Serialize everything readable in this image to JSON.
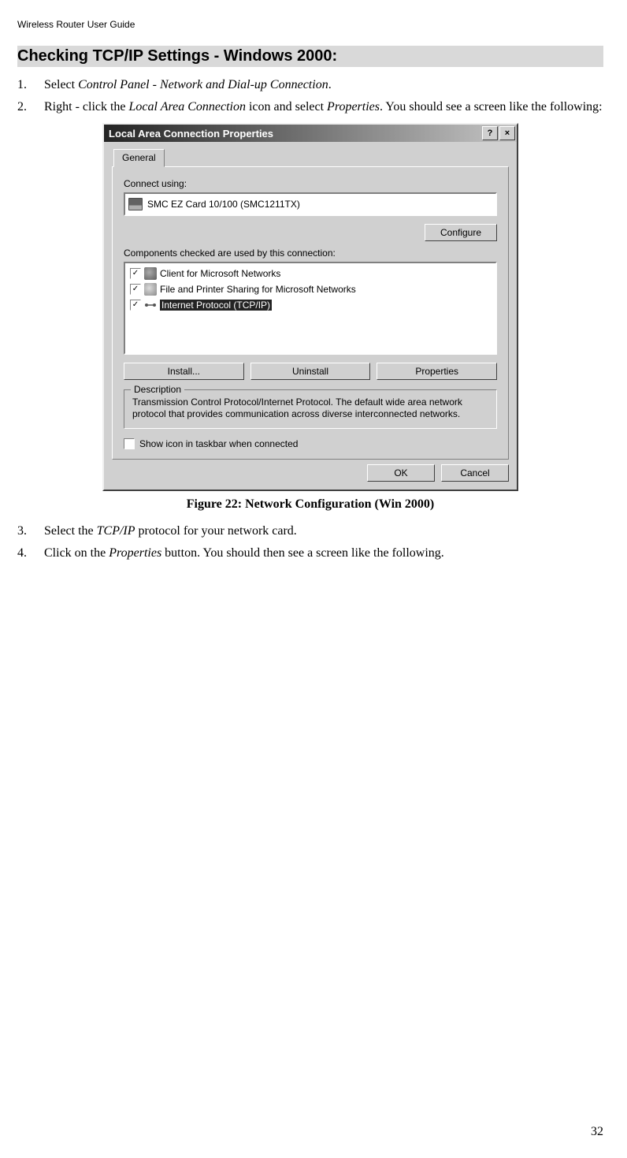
{
  "header": {
    "running_head": "Wireless Router User Guide"
  },
  "section": {
    "title": "Checking TCP/IP Settings - Windows 2000:"
  },
  "steps": {
    "s1": {
      "marker": "1.",
      "before": "Select ",
      "em": "Control Panel - Network and Dial-up Connection",
      "after": "."
    },
    "s2": {
      "marker": "2.",
      "before": "Right - click the ",
      "em1": "Local Area Connection",
      "mid": " icon and select ",
      "em2": "Properties",
      "after": ". You should see a screen like the following:"
    },
    "s3": {
      "marker": "3.",
      "before": "Select the ",
      "em": "TCP/IP",
      "after": " protocol for your network card."
    },
    "s4": {
      "marker": "4.",
      "before": "Click on the ",
      "em": "Properties",
      "after": " button. You should then see a screen like the following."
    }
  },
  "figure": {
    "caption": "Figure 22: Network Configuration (Win 2000)"
  },
  "dialog": {
    "title": "Local Area Connection Properties",
    "help_btn": "?",
    "close_btn": "×",
    "tab_general": "General",
    "connect_using_label": "Connect using:",
    "adapter": "SMC EZ Card 10/100 (SMC1211TX)",
    "configure_btn": "Configure",
    "components_label": "Components checked are used by this connection:",
    "items": {
      "client": "Client for Microsoft Networks",
      "share": "File and Printer Sharing for Microsoft Networks",
      "proto": "Internet Protocol (TCP/IP)"
    },
    "install_btn": "Install...",
    "uninstall_btn": "Uninstall",
    "properties_btn": "Properties",
    "desc_legend": "Description",
    "desc_text": "Transmission Control Protocol/Internet Protocol. The default wide area network protocol that provides communication across diverse interconnected networks.",
    "show_icon_label": "Show icon in taskbar when connected",
    "ok_btn": "OK",
    "cancel_btn": "Cancel"
  },
  "footer": {
    "page_number": "32"
  }
}
